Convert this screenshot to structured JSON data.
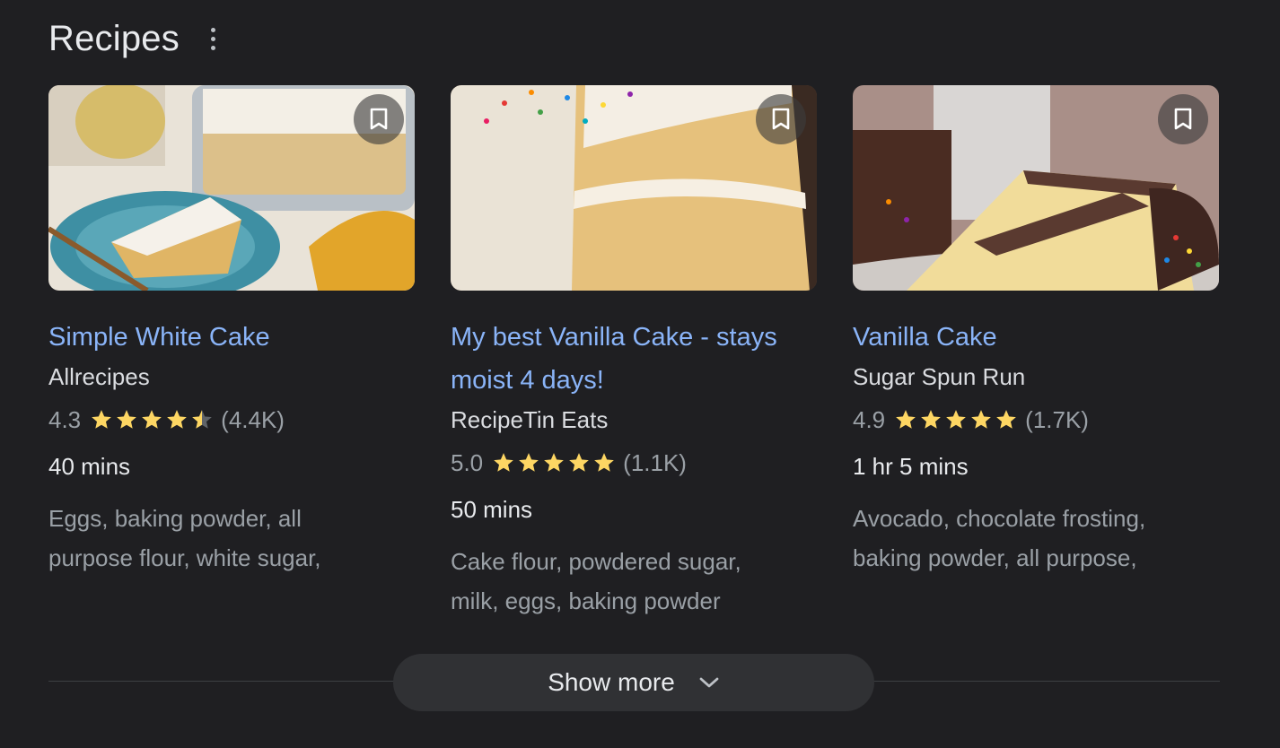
{
  "section": {
    "title": "Recipes"
  },
  "cards": [
    {
      "title": "Simple White Cake",
      "source": "Allrecipes",
      "rating": "4.3",
      "stars": 4.3,
      "reviews": "(4.4K)",
      "time": "40 mins",
      "ingredients": "Eggs, baking powder, all purpose flour, white sugar,"
    },
    {
      "title": "My best Vanilla Cake - stays moist 4 days!",
      "source": "RecipeTin Eats",
      "rating": "5.0",
      "stars": 5.0,
      "reviews": "(1.1K)",
      "time": "50 mins",
      "ingredients": "Cake flour, powdered sugar, milk, eggs, baking powder"
    },
    {
      "title": "Vanilla Cake",
      "source": "Sugar Spun Run",
      "rating": "4.9",
      "stars": 4.9,
      "reviews": "(1.7K)",
      "time": "1 hr 5 mins",
      "ingredients": "Avocado, chocolate frosting, baking powder, all purpose,"
    }
  ],
  "footer": {
    "show_more_label": "Show more"
  },
  "colors": {
    "link": "#8ab4f8",
    "star": "#fdd663",
    "star_empty": "#5f6368"
  },
  "icons": {
    "more": "more-vert-icon",
    "save": "bookmark-icon",
    "star": "star-icon",
    "expand": "chevron-down-icon"
  }
}
